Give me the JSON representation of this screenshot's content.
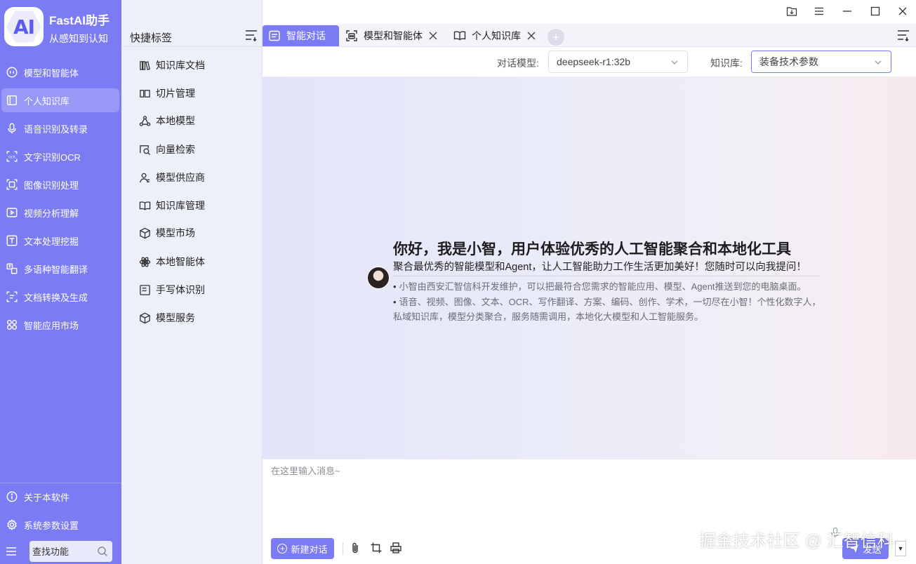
{
  "app": {
    "logo_text": "AI",
    "title": "FastAI助手",
    "subtitle": "从感知到认知"
  },
  "sidebar": {
    "items": [
      {
        "label": "模型和智能体",
        "icon": "robot-icon"
      },
      {
        "label": "个人知识库",
        "icon": "book-icon",
        "active": true
      },
      {
        "label": "语音识别及转录",
        "icon": "microphone-icon"
      },
      {
        "label": "文字识别OCR",
        "icon": "ocr-icon"
      },
      {
        "label": "图像识别处理",
        "icon": "image-scan-icon"
      },
      {
        "label": "视频分析理解",
        "icon": "video-icon"
      },
      {
        "label": "文本处理挖掘",
        "icon": "text-icon"
      },
      {
        "label": "多语种智能翻译",
        "icon": "translate-icon"
      },
      {
        "label": "文档转换及生成",
        "icon": "document-convert-icon"
      },
      {
        "label": "智能应用市场",
        "icon": "apps-grid-icon"
      }
    ],
    "bottom": [
      {
        "label": "关于本软件",
        "icon": "info-icon"
      },
      {
        "label": "系统参数设置",
        "icon": "gear-icon"
      }
    ],
    "search_placeholder": "查找功能"
  },
  "quick": {
    "title": "快捷标签",
    "items": [
      {
        "label": "知识库文档",
        "icon": "library-icon"
      },
      {
        "label": "切片管理",
        "icon": "slice-icon"
      },
      {
        "label": "本地模型",
        "icon": "network-icon"
      },
      {
        "label": "向量检索",
        "icon": "vector-search-icon"
      },
      {
        "label": "模型供应商",
        "icon": "user-supplier-icon"
      },
      {
        "label": "知识库管理",
        "icon": "open-book-icon"
      },
      {
        "label": "模型市场",
        "icon": "cube-market-icon"
      },
      {
        "label": "本地智能体",
        "icon": "atom-icon"
      },
      {
        "label": "手写体识别",
        "icon": "handwriting-icon"
      },
      {
        "label": "模型服务",
        "icon": "cube-icon"
      }
    ]
  },
  "tabs": [
    {
      "label": "智能对话",
      "icon": "chat-icon",
      "active": true
    },
    {
      "label": "模型和智能体",
      "icon": "robot-icon"
    },
    {
      "label": "个人知识库",
      "icon": "open-book-icon"
    }
  ],
  "toolbar": {
    "model_label": "对话模型:",
    "model_value": "deepseek-r1:32b",
    "kb_label": "知识库:",
    "kb_value": "装备技术参数"
  },
  "welcome": {
    "title": "你好，我是小智，用户体验优秀的人工智能聚合和本地化工具",
    "subtitle": "聚合最优秀的智能模型和Agent，让人工智能助力工作生活更加美好！您随时可以向我提问！",
    "bullets": [
      "小智由西安汇智信科开发维护，可以把最符合您需求的智能应用、模型、Agent推送到您的电脑桌面。",
      "语音、视频、图像、文本、OCR、写作翻译、方案、编码、创作、学术，一切尽在小智！个性化数字人，私域知识库，模型分类聚合，服务随需调用，本地化大模型和人工智能服务。"
    ]
  },
  "input": {
    "placeholder": "在这里输入消息~",
    "new_chat": "新建对话",
    "send": "发送"
  },
  "watermark": "掘金技术社区 @ 汇智信科",
  "colors": {
    "accent": "#7b7cf4",
    "sidebar_bg": "#7b7cf4",
    "quick_bg": "#eef0f9"
  }
}
